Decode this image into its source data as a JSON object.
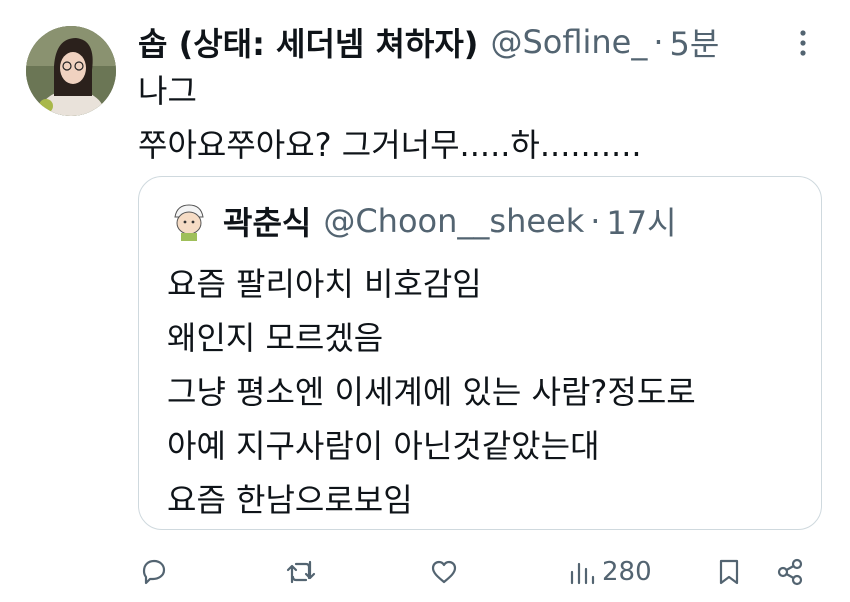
{
  "tweet": {
    "display_name": "솝 (상태: 세더넴 쳐하자)",
    "handle": "@Sofline_",
    "separator": "·",
    "time": "5분",
    "text_lines": [
      "나그",
      "쭈아요쭈아요? 그거너무.....하.........."
    ]
  },
  "quote": {
    "display_name": "곽춘식",
    "handle": "@Choon__sheek",
    "separator": "·",
    "time": "17시",
    "text_lines": [
      "요즘 팔리아치 비호감임",
      "왜인지 모르겠음",
      "그냥 평소엔 이세계에 있는 사람?정도로",
      "아예 지구사람이 아닌것같았는대",
      "요즘 한남으로보임"
    ]
  },
  "actions": {
    "views_count": "280"
  },
  "colors": {
    "text": "#0f1419",
    "secondary": "#536471",
    "border": "#cfd9de"
  },
  "icons": [
    "more-icon",
    "reply-icon",
    "retweet-icon",
    "like-icon",
    "views-icon",
    "bookmark-icon",
    "share-icon"
  ]
}
